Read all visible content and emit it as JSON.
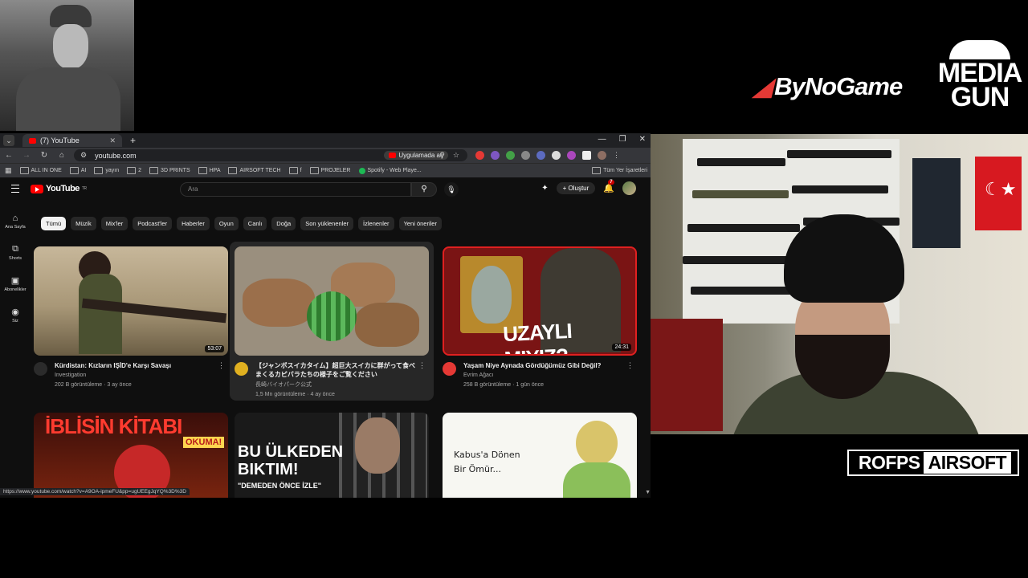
{
  "overlay": {
    "logo_left": "ByNoGame",
    "logo_right_line1": "MEDIA",
    "logo_right_line2": "GUN",
    "sponsor_left": "ROFPS",
    "sponsor_right": "AIRSOFT"
  },
  "browser": {
    "tab_title": "(7) YouTube",
    "url": "youtube.com",
    "open_in_app": "Uygulamada aç",
    "bookmarks": [
      "ALL IN ONE",
      "AI",
      "yayın",
      "2",
      "3D PRINTS",
      "HPA",
      "AIRSOFT TECH",
      "f",
      "PROJELER",
      "Spotify - Web Playe..."
    ],
    "bookmarks_right": "Tüm Yer İşaretleri",
    "status_url": "https://www.youtube.com/watch?v=A9OA-ipmeFU&pp=ugUEEgJqYQ%3D%3D"
  },
  "youtube": {
    "logo": "YouTube",
    "region": "TR",
    "search_placeholder": "Ara",
    "create_label": "Oluştur",
    "notif_count": "7",
    "guide": [
      {
        "icon": "home-icon",
        "label": "Ana Sayfa"
      },
      {
        "icon": "shorts-icon",
        "label": "Shorts"
      },
      {
        "icon": "subscriptions-icon",
        "label": "Abonelikler"
      },
      {
        "icon": "you-icon",
        "label": "Siz"
      }
    ],
    "chips": [
      "Tümü",
      "Müzik",
      "Mix'ler",
      "Podcast'ler",
      "Haberler",
      "Oyun",
      "Canlı",
      "Doğa",
      "Son yüklenenler",
      "İzlenenler",
      "Yeni öneriler"
    ],
    "videos": [
      {
        "title": "Kürdistan: Kızların IŞİD'e Karşı Savaşı",
        "channel": "Investigation",
        "meta": "202 B görüntüleme · 3 ay önce",
        "duration": "53:07"
      },
      {
        "title": "【ジャンボスイカタイム】超巨大スイカに群がって食べまくるカピバラたちの様子をご覧ください",
        "channel": "長崎バイオパーク公式",
        "meta": "1,5 Mn görüntüleme · 4 ay önce",
        "duration": ""
      },
      {
        "title": "Yaşam Niye Aynada Gördüğümüz Gibi Değil?",
        "channel": "Evrim Ağacı",
        "meta": "258 B görüntüleme · 1 gün önce",
        "duration": "24:31"
      }
    ],
    "thumb_texts": {
      "v3": "UZAYLI MIYIZ?",
      "v4_main": "İBLİSİN KİTABI",
      "v4_badge": "OKUMA!",
      "v5_line1": "BU ÜLKEDEN",
      "v5_line2": "BIKTIM!",
      "v5_sub": "\"DEMEDEN ÖNCE İZLE\"",
      "v6_line1": "Kabus'a Dönen",
      "v6_line2": "Bir Ömür..."
    }
  }
}
